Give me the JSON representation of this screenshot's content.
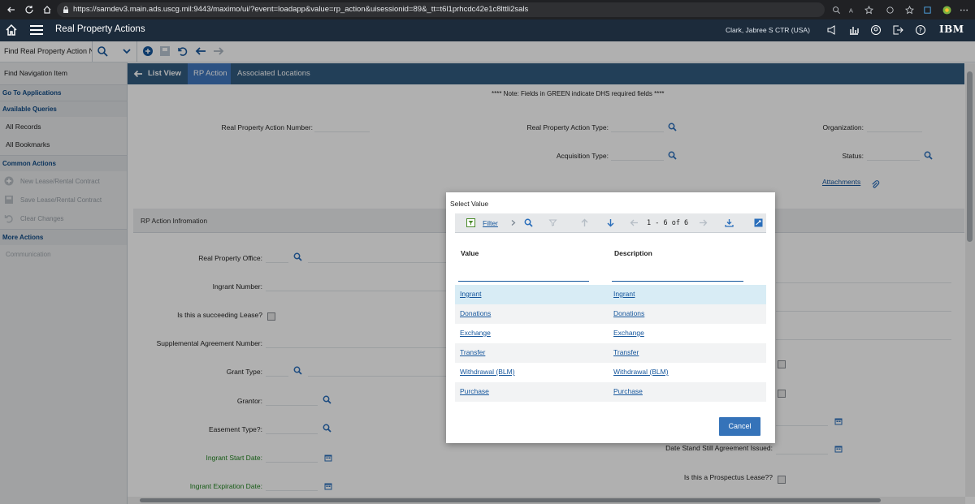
{
  "browser": {
    "url": "https://samdev3.main.ads.uscg.mil:9443/maximo/ui/?event=loadapp&value=rp_action&uisessionid=89&_tt=t6l1prhcdc42e1c8lttli2sals"
  },
  "app": {
    "title": "Real Property Actions",
    "user": "Clark, Jabree S CTR (USA)",
    "brand": "IBM"
  },
  "toolbar": {
    "find_placeholder": "Find Real Property Action N"
  },
  "sidebar": {
    "find_nav": "Find Navigation Item",
    "go_to_apps": "Go To Applications",
    "available_queries": "Available Queries",
    "all_records": "All Records",
    "all_bookmarks": "All Bookmarks",
    "common_actions": "Common Actions",
    "new_lease": "New Lease/Rental Contract",
    "save_lease": "Save Lease/Rental Contract",
    "clear_changes": "Clear Changes",
    "more_actions": "More Actions",
    "communication": "Communication"
  },
  "tabs": {
    "list_view": "List View",
    "rp_action": "RP Action",
    "associated_locations": "Associated Locations"
  },
  "form": {
    "note": "**** Note: Fields in GREEN indicate DHS required fields ****",
    "rpa_number": "Real Property Action Number:",
    "rpa_type": "Real Property Action Type:",
    "organization": "Organization:",
    "acquisition_type": "Acquisition Type:",
    "status": "Status:",
    "attachments": "Attachments",
    "section_title": "RP Action Infromation",
    "rp_office": "Real Property Office:",
    "ingrant_number": "Ingrant Number:",
    "succeeding_lease": "Is this a succeeding Lease?",
    "supp_agreement": "Supplemental Agreement Number:",
    "grant_type": "Grant Type:",
    "grantor": "Grantor:",
    "easement_type": "Easement Type?:",
    "ingrant_start": "Ingrant Start Date:",
    "ingrant_expiration": "Ingrant Expiration Date:",
    "stand_still_date": "Date Stand Still Agreement Issued:",
    "prospectus_lease": "Is this a Prospectus Lease??"
  },
  "modal": {
    "title": "Select Value",
    "filter_label": "Filter",
    "pagination": "1 - 6 of 6",
    "col_value": "Value",
    "col_description": "Description",
    "rows": [
      {
        "value": "Ingrant",
        "description": "Ingrant"
      },
      {
        "value": "Donations",
        "description": "Donations"
      },
      {
        "value": "Exchange",
        "description": "Exchange"
      },
      {
        "value": "Transfer",
        "description": "Transfer"
      },
      {
        "value": "Withdrawal (BLM)",
        "description": "Withdrawal (BLM)"
      },
      {
        "value": "Purchase",
        "description": "Purchase"
      }
    ],
    "cancel_label": "Cancel"
  },
  "colors": {
    "app_bar": "#1c2b3b",
    "tab_bar": "#325c80",
    "active_tab": "#4178be",
    "required_green": "#21841f",
    "link_blue": "#15569c",
    "button_blue": "#3573b9",
    "selected_row": "#d8ecf5"
  }
}
